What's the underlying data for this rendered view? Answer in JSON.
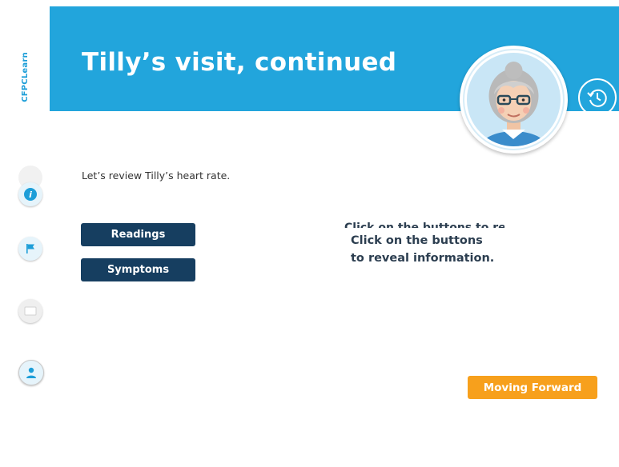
{
  "app": {
    "brand": "CFPCLearn"
  },
  "header": {
    "title": "Tilly’s visit, continued"
  },
  "content": {
    "intro": "Let’s review Tilly’s heart rate.",
    "buttons": {
      "readings": "Readings",
      "symptoms": "Symptoms"
    },
    "hint": "Click on the buttons to reveal information.",
    "forward_label": "Moving Forward"
  },
  "sidebar": {
    "icons": [
      "info-icon",
      "flag-icon",
      "book-icon",
      "user-icon"
    ]
  },
  "colors": {
    "header": "#22a5dc",
    "accent": "#1d9ed8",
    "primary_button": "#163e60",
    "forward_button": "#f7a01c"
  }
}
